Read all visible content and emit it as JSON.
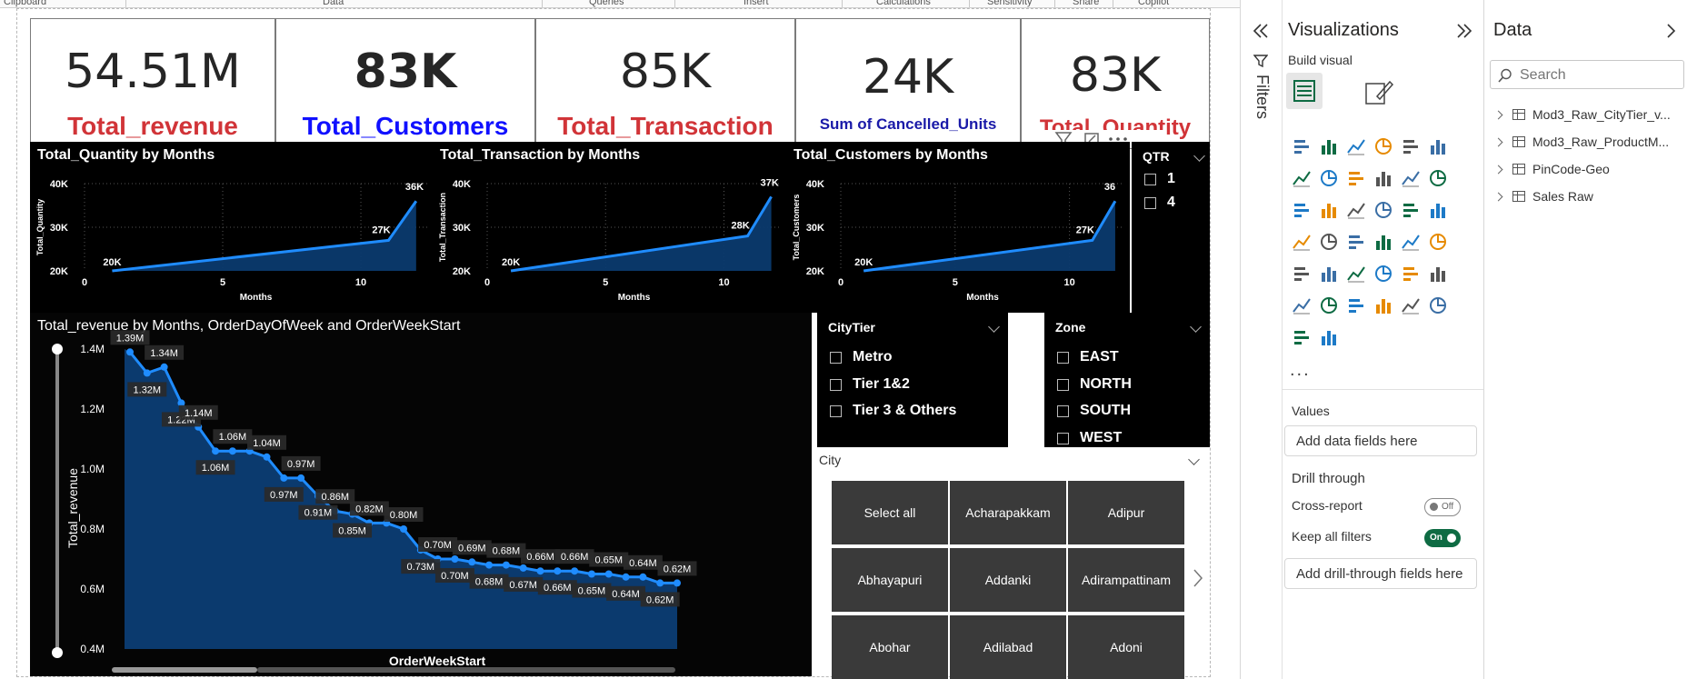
{
  "ribbon": {
    "groups": [
      "Clipboard",
      "Data",
      "Queries",
      "Insert",
      "Calculations",
      "Sensitivity",
      "Share",
      "Copilot"
    ]
  },
  "cards": [
    {
      "value": "54.51M",
      "label": "Total_revenue",
      "label_color": "#d13438"
    },
    {
      "value": "83K",
      "label": "Total_Customers",
      "label_color": "#1010ff"
    },
    {
      "value": "85K",
      "label": "Total_Transaction",
      "label_color": "#d13438"
    },
    {
      "value": "24K",
      "label": "Sum of Cancelled_Units",
      "label_color": "#1a1aa8"
    },
    {
      "value": "83K",
      "label": "Total_Quantity",
      "label_color": "#d13438"
    }
  ],
  "chart_data": [
    {
      "type": "area",
      "title": "Total_Quantity by Months",
      "xlabel": "Months",
      "ylabel": "Total_Quantity",
      "y_ticks": [
        "40K",
        "30K",
        "20K"
      ],
      "x_ticks": [
        "0",
        "5",
        "10"
      ],
      "xlim": [
        0,
        12.4
      ],
      "ylim": [
        20000,
        40000
      ],
      "x": [
        1,
        11,
        12
      ],
      "values": [
        20000,
        27000,
        36000
      ],
      "point_labels": [
        "20K",
        "27K",
        "36K"
      ]
    },
    {
      "type": "area",
      "title": "Total_Transaction by Months",
      "xlabel": "Months",
      "ylabel": "Total_Transaction",
      "y_ticks": [
        "40K",
        "30K",
        "20K"
      ],
      "x_ticks": [
        "0",
        "5",
        "10"
      ],
      "xlim": [
        0,
        12.4
      ],
      "ylim": [
        20000,
        40000
      ],
      "x": [
        1,
        11,
        12
      ],
      "values": [
        20000,
        28000,
        37000
      ],
      "point_labels": [
        "20K",
        "28K",
        "37K"
      ]
    },
    {
      "type": "area",
      "title": "Total_Customers by Months",
      "xlabel": "Months",
      "ylabel": "Total_Customers",
      "y_ticks": [
        "40K",
        "30K",
        "20K"
      ],
      "x_ticks": [
        "0",
        "5",
        "10"
      ],
      "xlim": [
        0,
        12.4
      ],
      "ylim": [
        20000,
        40000
      ],
      "x": [
        1,
        11,
        12
      ],
      "values": [
        20000,
        27000,
        36000
      ],
      "point_labels": [
        "20K",
        "27K",
        "36"
      ]
    },
    {
      "type": "area",
      "title": "Total_revenue by Months, OrderDayOfWeek and OrderWeekStart",
      "xlabel": "OrderWeekStart",
      "ylabel": "Total_revenue",
      "y_ticks": [
        "1.4M",
        "1.2M",
        "1.0M",
        "0.8M",
        "0.6M",
        "0.4M"
      ],
      "ylim": [
        0.4,
        1.4
      ],
      "values": [
        1.39,
        1.32,
        1.34,
        1.22,
        1.14,
        1.06,
        1.06,
        1.06,
        1.04,
        0.97,
        0.97,
        0.91,
        0.86,
        0.85,
        0.82,
        0.82,
        0.8,
        0.73,
        0.7,
        0.7,
        0.69,
        0.68,
        0.68,
        0.67,
        0.66,
        0.66,
        0.66,
        0.65,
        0.65,
        0.64,
        0.64,
        0.62,
        0.62
      ],
      "point_labels": [
        "1.39M",
        "1.32M",
        "1.34M",
        "1.22M",
        "1.14M",
        "1.06M",
        "1.06M",
        "",
        "1.04M",
        "0.97M",
        "0.97M",
        "0.91M",
        "0.86M",
        "0.85M",
        "0.82M",
        "",
        "0.80M",
        "0.73M",
        "0.70M",
        "0.70M",
        "0.69M",
        "0.68M",
        "0.68M",
        "0.67M",
        "0.66M",
        "0.66M",
        "0.66M",
        "0.65M",
        "0.65M",
        "0.64M",
        "0.64M",
        "0.62M",
        "0.62M"
      ]
    }
  ],
  "slicers": {
    "qtr": {
      "title": "QTR",
      "items": [
        "1",
        "4"
      ]
    },
    "citytier": {
      "title": "CityTier",
      "items": [
        "Metro",
        "Tier 1&2",
        "Tier 3 & Others"
      ]
    },
    "zone": {
      "title": "Zone",
      "items": [
        "EAST",
        "NORTH",
        "SOUTH",
        "WEST"
      ]
    },
    "city": {
      "title": "City",
      "tiles": [
        "Select all",
        "Acharapakkam",
        "Adipur",
        "Abhayapuri",
        "Addanki",
        "Adirampattinam",
        "Abohar",
        "Adilabad",
        "Adoni"
      ]
    }
  },
  "filters_pane": {
    "label": "Filters"
  },
  "visualizations": {
    "title": "Visualizations",
    "build_visual": "Build visual",
    "more": "...",
    "values_label": "Values",
    "values_placeholder": "Add data fields here",
    "drill_through": "Drill through",
    "cross_report": "Cross-report",
    "cross_report_state": "Off",
    "keep_all_filters": "Keep all filters",
    "keep_all_filters_state": "On",
    "drill_placeholder": "Add drill-through fields here",
    "icon_names": [
      "stacked-bar-icon",
      "stacked-column-icon",
      "clustered-bar-icon",
      "clustered-column-icon",
      "100-bar-icon",
      "100-column-icon",
      "line-chart-icon",
      "area-chart-icon",
      "stacked-area-icon",
      "ribbon-chart-icon",
      "line-column-icon",
      "waterfall-icon",
      "line-stacked-icon",
      "funnel-icon",
      "scatter-icon",
      "pie-icon",
      "donut-icon",
      "treemap-icon",
      "map-icon",
      "filled-map-icon",
      "azure-map-icon",
      "gauge-icon",
      "card-icon",
      "kpi-icon",
      "multi-card-icon",
      "slicer-icon",
      "table-icon",
      "matrix-icon",
      "r-visual-icon",
      "python-visual-icon",
      "key-influencers-icon",
      "decomposition-tree-icon",
      "qa-icon",
      "narrative-icon",
      "paginated-icon",
      "goals-icon",
      "power-apps-icon",
      "power-automate-icon"
    ]
  },
  "data_pane": {
    "title": "Data",
    "search_placeholder": "Search",
    "tables": [
      "Mod3_Raw_CityTier_v...",
      "Mod3_Raw_ProductM...",
      "PinCode-Geo",
      "Sales Raw"
    ]
  },
  "colors": {
    "accent_line": "#1f8cff",
    "area_fill": "#0b3a6e",
    "panel_bg": "#000000",
    "toggle_on": "#0e6b43"
  }
}
